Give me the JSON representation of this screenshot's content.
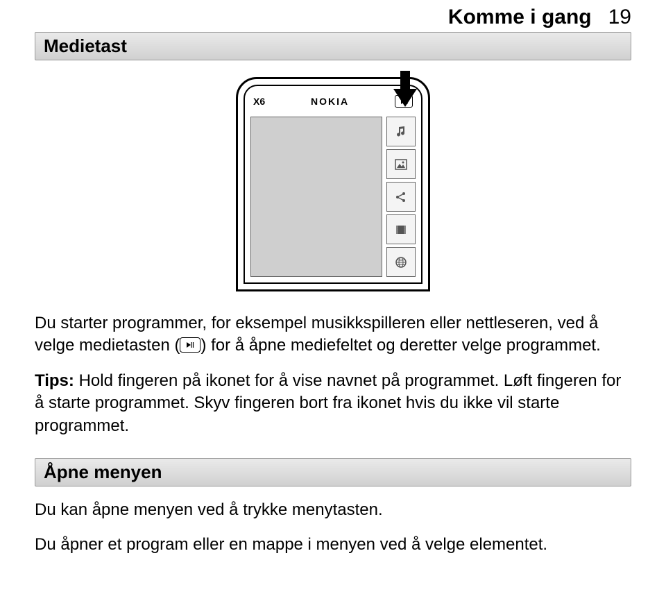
{
  "header": {
    "title": "Komme i gang",
    "page": "19"
  },
  "section1": {
    "title": "Medietast"
  },
  "phone": {
    "model": "X6",
    "brand": "NOKIA",
    "side_icons": [
      "music",
      "image",
      "share",
      "video",
      "globe"
    ]
  },
  "para1": {
    "t1": "Du starter programmer, for eksempel musikkspilleren eller nettleseren, ved å velge medietasten (",
    "t2": ") for å åpne mediefeltet og deretter velge programmet."
  },
  "tips": {
    "label": "Tips:",
    "text": " Hold fingeren på ikonet for å vise navnet på programmet. Løft fingeren for å starte programmet. Skyv fingeren bort fra ikonet hvis du ikke vil starte programmet."
  },
  "section2": {
    "title": "Åpne menyen"
  },
  "para2": "Du kan åpne menyen ved å trykke menytasten.",
  "para3": "Du åpner et program eller en mappe i menyen ved å velge elementet."
}
